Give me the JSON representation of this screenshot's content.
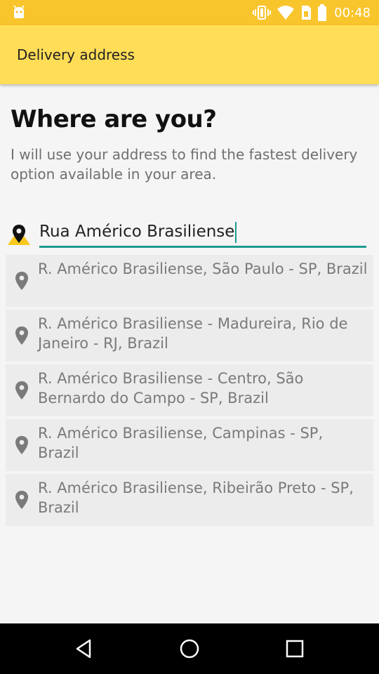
{
  "status_bar": {
    "time": "00:48",
    "icons": [
      "android-icon",
      "vibrate-icon",
      "wifi-icon",
      "sim-icon",
      "battery-icon"
    ]
  },
  "app_bar": {
    "title": "Delivery address",
    "color": "#ffdd57"
  },
  "main": {
    "heading": "Where are you?",
    "description": "I will use your address to find the fastest delivery option available in your area.",
    "search": {
      "value": "Rua Américo Brasiliense",
      "icon": "location-pin-icon"
    },
    "suggestions": [
      {
        "text": "R. Américo Brasiliense, São Paulo - SP, Brazil",
        "icon": "place-icon"
      },
      {
        "text": "R. Américo Brasiliense - Madureira, Rio de Janeiro - RJ, Brazil",
        "icon": "place-icon"
      },
      {
        "text": "R. Américo Brasiliense - Centro, São Bernardo do Campo - SP, Brazil",
        "icon": "place-icon"
      },
      {
        "text": "R. Américo Brasiliense, Campinas - SP, Brazil",
        "icon": "place-icon"
      },
      {
        "text": "R. Américo Brasiliense, Ribeirão Preto - SP, Brazil",
        "icon": "place-icon"
      }
    ]
  },
  "nav_bar": {
    "buttons": [
      "back-icon",
      "home-icon",
      "recents-icon"
    ]
  },
  "colors": {
    "status_bar": "#f9c52d",
    "accent": "#1e9a8e",
    "suggestion_bg": "#ececec"
  }
}
